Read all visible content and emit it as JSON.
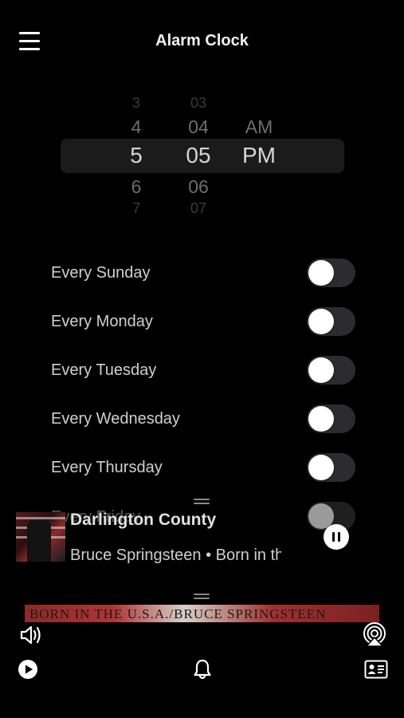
{
  "header": {
    "title": "Alarm Clock"
  },
  "picker": {
    "hours": [
      "3",
      "4",
      "5",
      "6",
      "7"
    ],
    "minutes": [
      "03",
      "04",
      "05",
      "06",
      "07"
    ],
    "ampm": [
      "AM",
      "PM"
    ],
    "selected": {
      "hour": "5",
      "minute": "05",
      "ampm": "PM"
    }
  },
  "days": [
    {
      "label": "Every Sunday",
      "on": false
    },
    {
      "label": "Every Monday",
      "on": false
    },
    {
      "label": "Every Tuesday",
      "on": false
    },
    {
      "label": "Every Wednesday",
      "on": false
    },
    {
      "label": "Every Thursday",
      "on": false
    },
    {
      "label": "Every Friday",
      "on": false
    }
  ],
  "now_playing": {
    "title": "Darlington County",
    "subtitle": "Bruce Springsteen • Born in the U.S.A.",
    "album_banner_text": "BORN IN THE U.S.A./BRUCE SPRINGSTEEN"
  }
}
